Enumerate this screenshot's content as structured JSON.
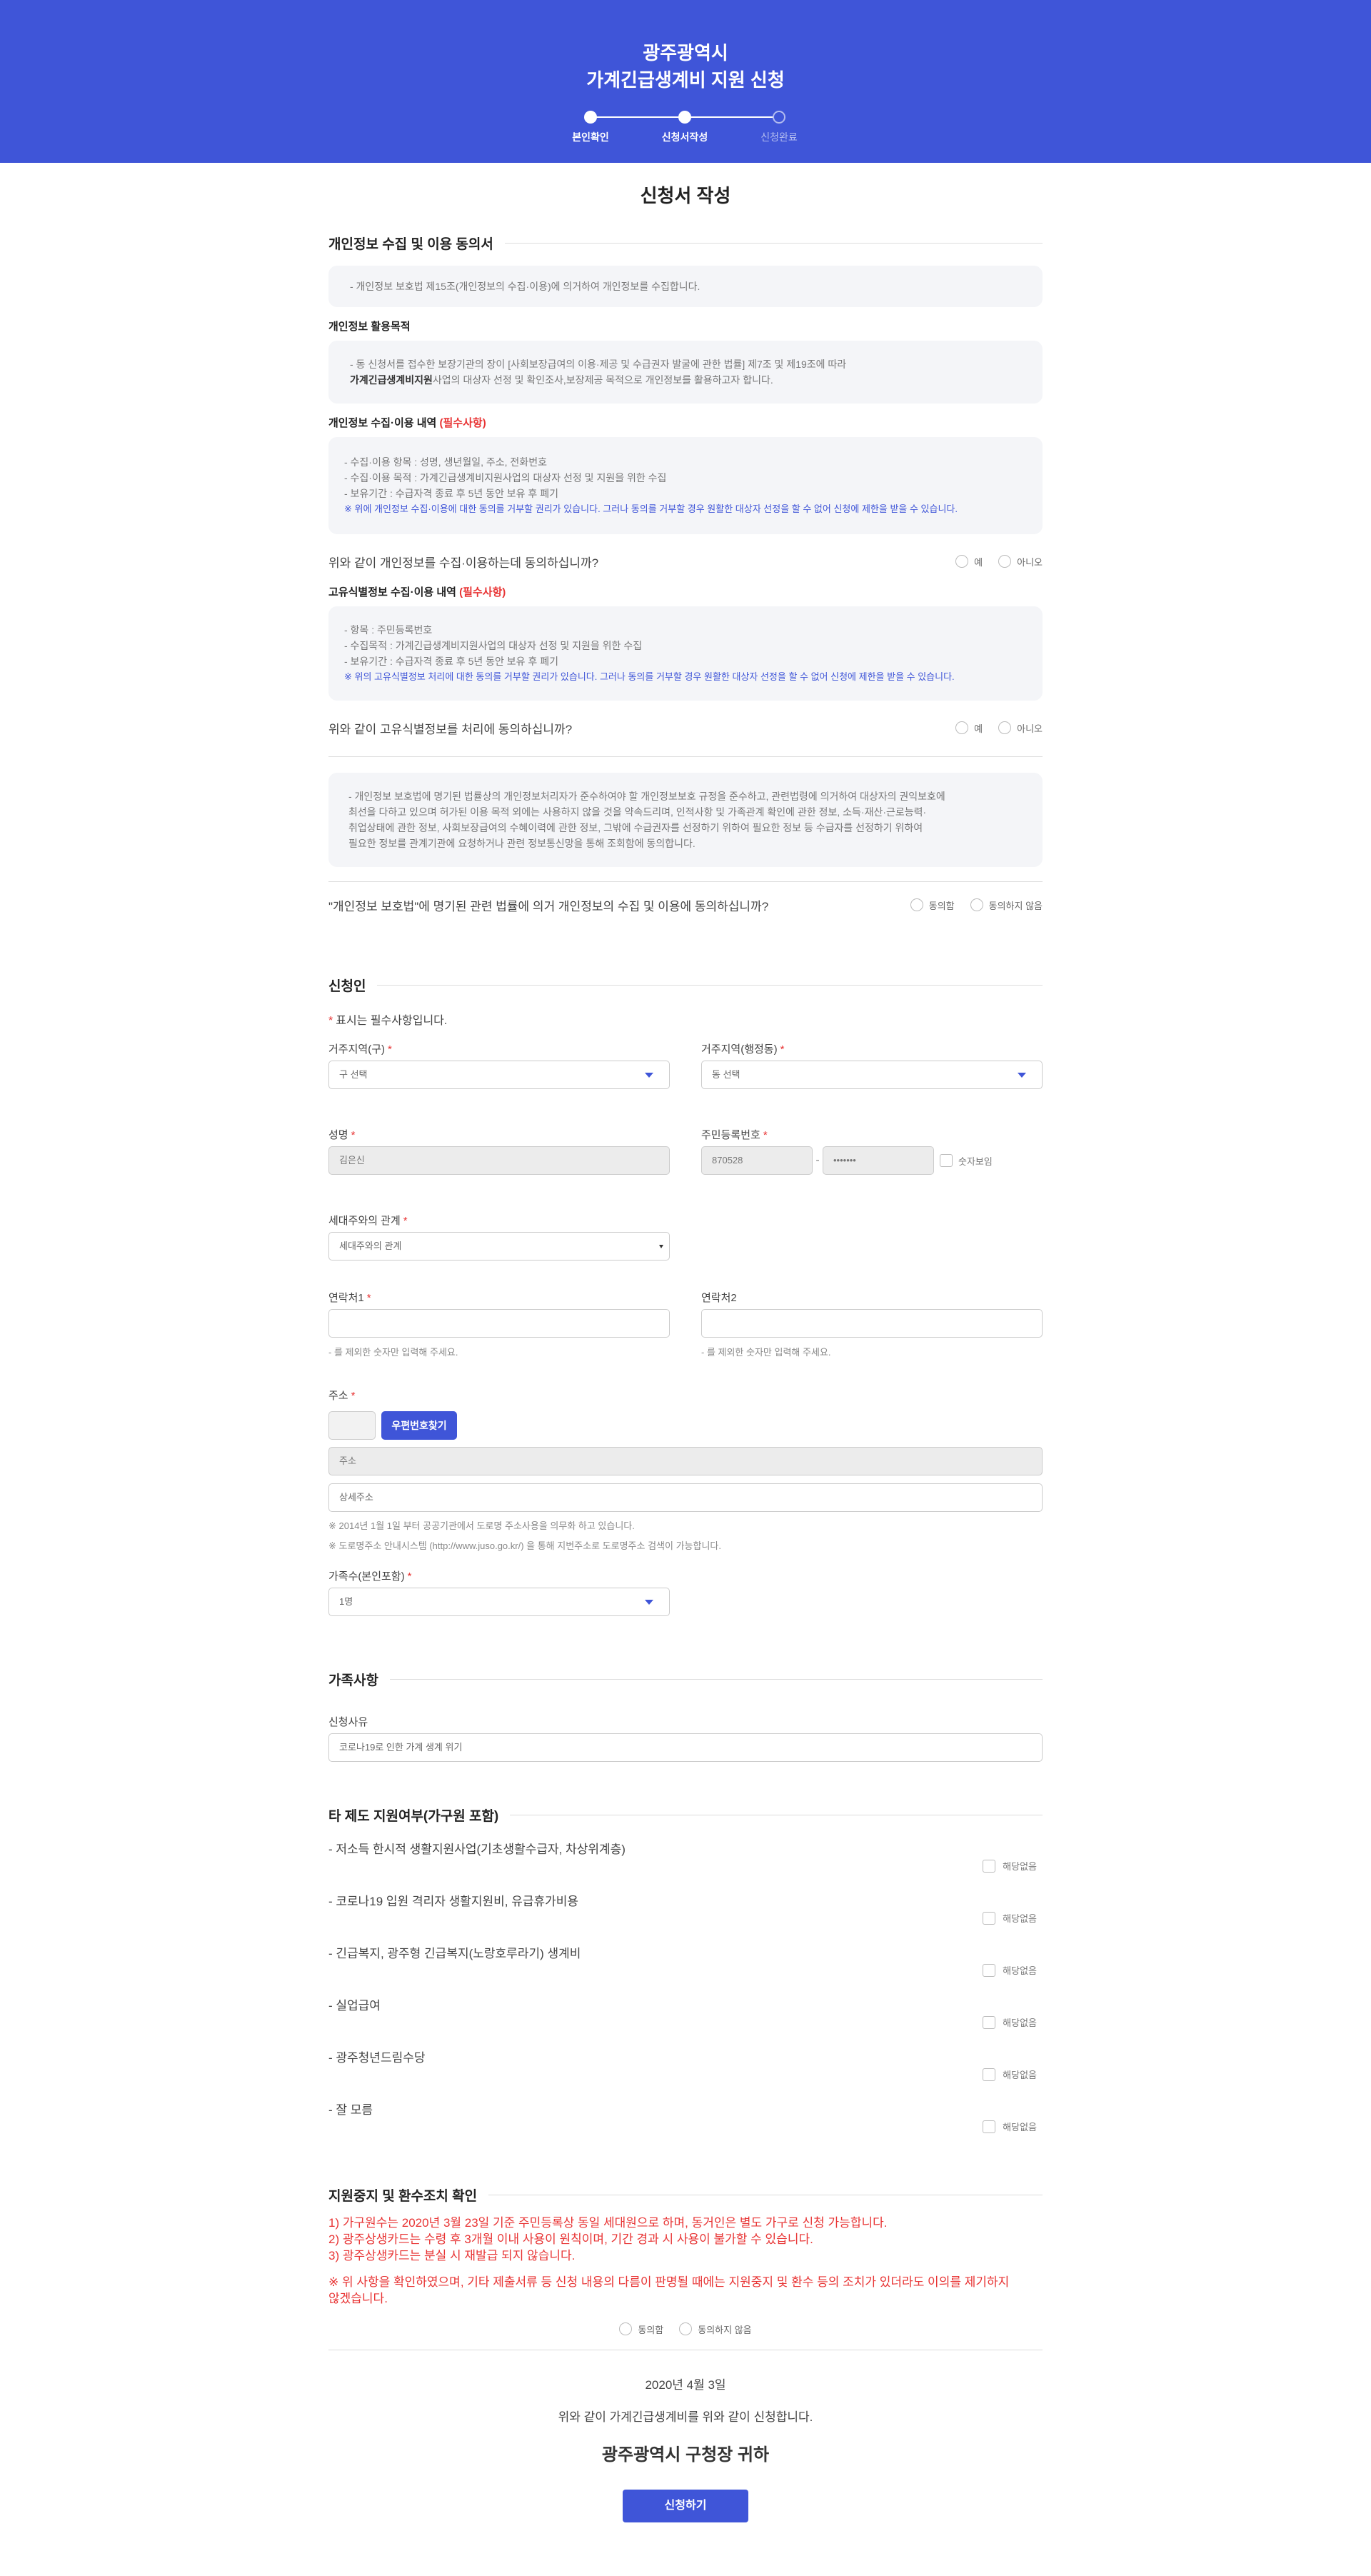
{
  "header": {
    "line1": "광주광역시",
    "line2": "가계긴급생계비 지원 신청",
    "steps": [
      "본인확인",
      "신청서작성",
      "신청완료"
    ]
  },
  "page_title": "신청서 작성",
  "consent": {
    "title": "개인정보 수집 및 이용 동의서",
    "intro": "- 개인정보 보호법 제15조(개인정보의 수집·이용)에 의거하여 개인정보를 수집합니다.",
    "purpose_title": "개인정보 활용목적",
    "purpose_line1": "- 동 신청서를 접수한 보장기관의 장이 [사회보장급여의 이용·제공 및 수급권자 발굴에 관한 법률] 제7조 및 제19조에 따라",
    "purpose_strong": "가계긴급생계비지원",
    "purpose_line2": "사업의 대상자 선정 및 확인조사,보장제공 목적으로 개인정보를 활용하고자 합니다.",
    "collect_title": "개인정보 수집·이용 내역",
    "required_tag": "(필수사항)",
    "collect_items": [
      "- 수집·이용 항목 : 성명, 생년월일, 주소, 전화번호",
      "- 수집·이용 목적 : 가계긴급생계비지원사업의 대상자 선정 및 지원을 위한 수집",
      "- 보유기간 : 수급자격 종료 후 5년 동안 보유 후 폐기"
    ],
    "collect_note": "※ 위에 개인정보 수집·이용에 대한 동의를 거부할 권리가 있습니다. 그러나 동의를 거부할 경우 원활한 대상자 선정을 할 수 없어 신청에 제한을 받을 수 있습니다.",
    "q1": "위와 같이 개인정보를 수집·이용하는데 동의하십니까?",
    "yes": "예",
    "no": "아니오",
    "unique_title": "고유식별정보 수집·이용 내역",
    "unique_items": [
      "- 항목 : 주민등록번호",
      "- 수집목적 : 가계긴급생계비지원사업의 대상자 선정 및 지원을 위한 수집",
      "- 보유기간 : 수급자격 종료 후 5년 동안 보유 후 폐기"
    ],
    "unique_note": "※ 위의 고유식별정보 처리에 대한 동의를 거부할 권리가 있습니다. 그러나 동의를 거부할 경우 원활한 대상자 선정을 할 수 없어 신청에 제한을 받을 수 있습니다.",
    "q2": "위와 같이 고유식별정보를 처리에 동의하십니까?",
    "law_text": [
      "- 개인정보 보호법에 명기된 법률상의 개인정보처리자가 준수하여야 할 개인정보보호 규정을 준수하고, 관련법령에 의거하여 대상자의 권익보호에",
      "최선을 다하고 있으며 허가된 이용 목적 외에는 사용하지 않을 것을 약속드리며, 인적사항 및 가족관계 확인에 관한 정보, 소득·재산·근로능력·",
      "취업상태에 관한 정보, 사회보장급여의 수혜이력에 관한 정보, 그밖에 수급권자를 선정하기 위하여 필요한 정보 등 수급자를 선정하기 위하여",
      "필요한 정보를 관계기관에 요청하거나 관련 정보통신망을 통해 조회함에 동의합니다."
    ],
    "q3": "\"개인정보 보호법\"에 명기된 관련 법률에 의거 개인정보의 수집 및 이용에 동의하십니까?",
    "agree": "동의함",
    "disagree": "동의하지 않음"
  },
  "applicant": {
    "title": "신청인",
    "req_note": "표시는 필수사항입니다.",
    "gu_label": "거주지역(구)",
    "gu_value": "구 선택",
    "dong_label": "거주지역(행정동)",
    "dong_value": "동 선택",
    "name_label": "성명",
    "name_value": "김은신",
    "ssn_label": "주민등록번호",
    "ssn_front": "870528",
    "ssn_back": "•••••••",
    "ssn_show": "숫자보임",
    "rel_label": "세대주와의 관계",
    "rel_value": "세대주와의 관계",
    "phone1_label": "연락처1",
    "phone2_label": "연락처2",
    "phone_hint": "- 를 제외한 숫자만 입력해 주세요.",
    "addr_label": "주소",
    "zip_button": "우편번호찾기",
    "addr_placeholder": "주소",
    "addr_detail_placeholder": "상세주소",
    "addr_note1": "※ 2014년 1월 1일 부터 공공기관에서 도로명 주소사용을 의무화 하고 있습니다.",
    "addr_note2": "※ 도로명주소 안내시스템 (http://www.juso.go.kr/) 을 통해 지번주소로 도로명주소 검색이 가능합니다.",
    "family_label": "가족수(본인포함)",
    "family_value": "1명"
  },
  "family": {
    "title": "가족사항",
    "reason_label": "신청사유",
    "reason_value": "코로나19로 인한 가계 생계 위기"
  },
  "other_support": {
    "title": "타 제도 지원여부(가구원 포함)",
    "na_label": "해당없음",
    "items": [
      "- 저소득 한시적 생활지원사업(기초생활수급자, 차상위계층)",
      "- 코로나19 입원 격리자 생활지원비, 유급휴가비용",
      "- 긴급복지, 광주형 긴급복지(노랑호루라기) 생계비",
      "- 실업급여",
      "- 광주청년드림수당",
      "- 잘 모름"
    ]
  },
  "refund": {
    "title": "지원중지 및 환수조치 확인",
    "lines": [
      "1) 가구원수는 2020년 3월 23일 기준 주민등록상 동일 세대원으로 하며, 동거인은 별도 가구로 신청 가능합니다.",
      "2) 광주상생카드는 수령 후 3개월 이내 사용이 원칙이며, 기간 경과 시 사용이 불가할 수 있습니다.",
      "3) 광주상생카드는 분실 시 재발급 되지 않습니다."
    ],
    "warn_line1": "※ 위 사항을 확인하였으며, 기타 제출서류 등 신청 내용의 다름이 판명될 때에는 지원중지 및 환수 등의 조치가 있더라도 이의를 제기하지",
    "warn_line2": "않겠습니다."
  },
  "final": {
    "date": "2020년 4월 3일",
    "text": "위와 같이 가계긴급생계비를 위와 같이 신청합니다.",
    "to": "광주광역시 구청장 귀하",
    "submit": "신청하기"
  },
  "colors": {
    "primary": "#3f55d8",
    "required": "#e83434",
    "box_bg": "#f4f5f8"
  }
}
